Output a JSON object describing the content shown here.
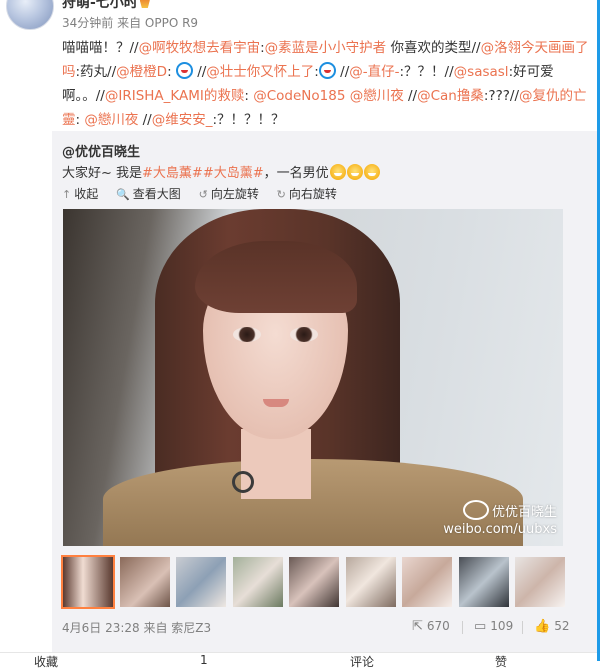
{
  "header": {
    "username": "狩萌-七小时",
    "meta": "34分钟前 来自 OPPO R9"
  },
  "post_text": {
    "segments": [
      {
        "t": "喵喵喵！？//"
      },
      {
        "t": "@啊牧牧想去看宇宙",
        "m": true
      },
      {
        "t": ":"
      },
      {
        "t": "@素蓝是小小守护者",
        "m": true
      },
      {
        "t": " 你喜欢的类型//"
      },
      {
        "t": "@洛翎今天画画了吗",
        "m": true
      },
      {
        "t": ":药丸//"
      },
      {
        "t": "@橙橙D",
        "m": true
      },
      {
        "t": ": ",
        "emoji": true
      },
      {
        "t": " //"
      },
      {
        "t": "@壮士你又怀上了",
        "m": true
      },
      {
        "t": ":",
        "emoji": true
      },
      {
        "t": " //"
      },
      {
        "t": "@-直仔-",
        "m": true
      },
      {
        "t": ":？？！//"
      },
      {
        "t": "@sasasl",
        "m": true
      },
      {
        "t": ":好可爱啊。。//"
      },
      {
        "t": "@IRISHA_KAMI的救赎",
        "m": true
      },
      {
        "t": ": "
      },
      {
        "t": "@CodeNo185",
        "m": true
      },
      {
        "t": " "
      },
      {
        "t": "@戀川夜",
        "m": true
      },
      {
        "t": " //"
      },
      {
        "t": "@Can撸桑",
        "m": true
      },
      {
        "t": ":???//"
      },
      {
        "t": "@复仇的亡靈",
        "m": true
      },
      {
        "t": ": "
      },
      {
        "t": "@戀川夜",
        "m": true
      },
      {
        "t": " //"
      },
      {
        "t": "@维安安_",
        "m": true
      },
      {
        "t": ":？！？！？"
      }
    ]
  },
  "original": {
    "author": "@优优百晓生",
    "text_prefix": "大家好~ 我是",
    "tag1": "#大島薫#",
    "tag2": "#大岛薰#",
    "text_suffix": "，一名男优",
    "tools": {
      "collapse": "收起",
      "view_large": "查看大图",
      "rotate_left": "向左旋转",
      "rotate_right": "向右旋转"
    },
    "watermark_name": "优优百晓生",
    "watermark_url": "weibo.com/uubxs",
    "thumb_count": 9
  },
  "footer": {
    "date": "4月6日 23:28 来自 索尼Z3",
    "repost_count": "670",
    "comment_count": "109",
    "like_count": "52"
  },
  "bottom_bar": {
    "collect": "收藏",
    "repost": "1",
    "comment": "评论",
    "like": "赞"
  },
  "colors": {
    "mention": "#eb7350",
    "thumb_selected": "#ff8140",
    "right_rule": "#1e9be8"
  }
}
